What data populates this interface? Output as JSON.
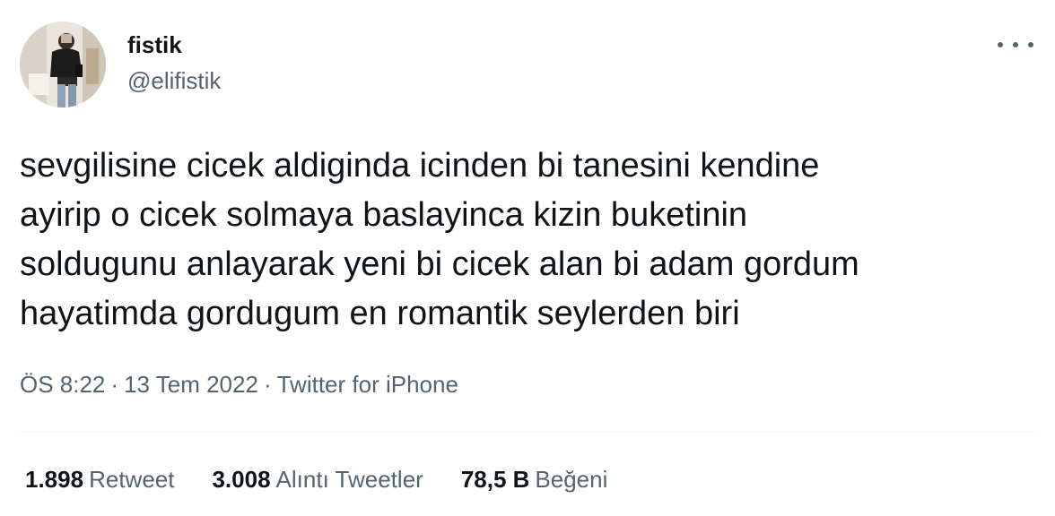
{
  "author": {
    "display_name": "fistik",
    "handle": "@elifistik",
    "avatar": "profile-photo"
  },
  "tweet": {
    "text": "sevgilisine cicek aldiginda icinden bi tanesini kendine\nayirip o cicek solmaya baslayinca kizin buketinin\nsoldugunu anlayarak yeni bi cicek alan bi adam gordum\nhayatimda gordugum en romantik seylerden biri"
  },
  "meta": {
    "time": "ÖS 8:22",
    "separator": "·",
    "date": "13 Tem 2022",
    "source": "Twitter for iPhone"
  },
  "stats": {
    "retweets": {
      "count": "1.898",
      "label": "Retweet"
    },
    "quotes": {
      "count": "3.008",
      "label": "Alıntı Tweetler"
    },
    "likes": {
      "count": "78,5 B",
      "label": "Beğeni"
    }
  },
  "icons": {
    "more": "more-horizontal-icon"
  },
  "colors": {
    "text_primary": "#0f1419",
    "text_secondary": "#536471",
    "divider": "#eff3f4"
  }
}
